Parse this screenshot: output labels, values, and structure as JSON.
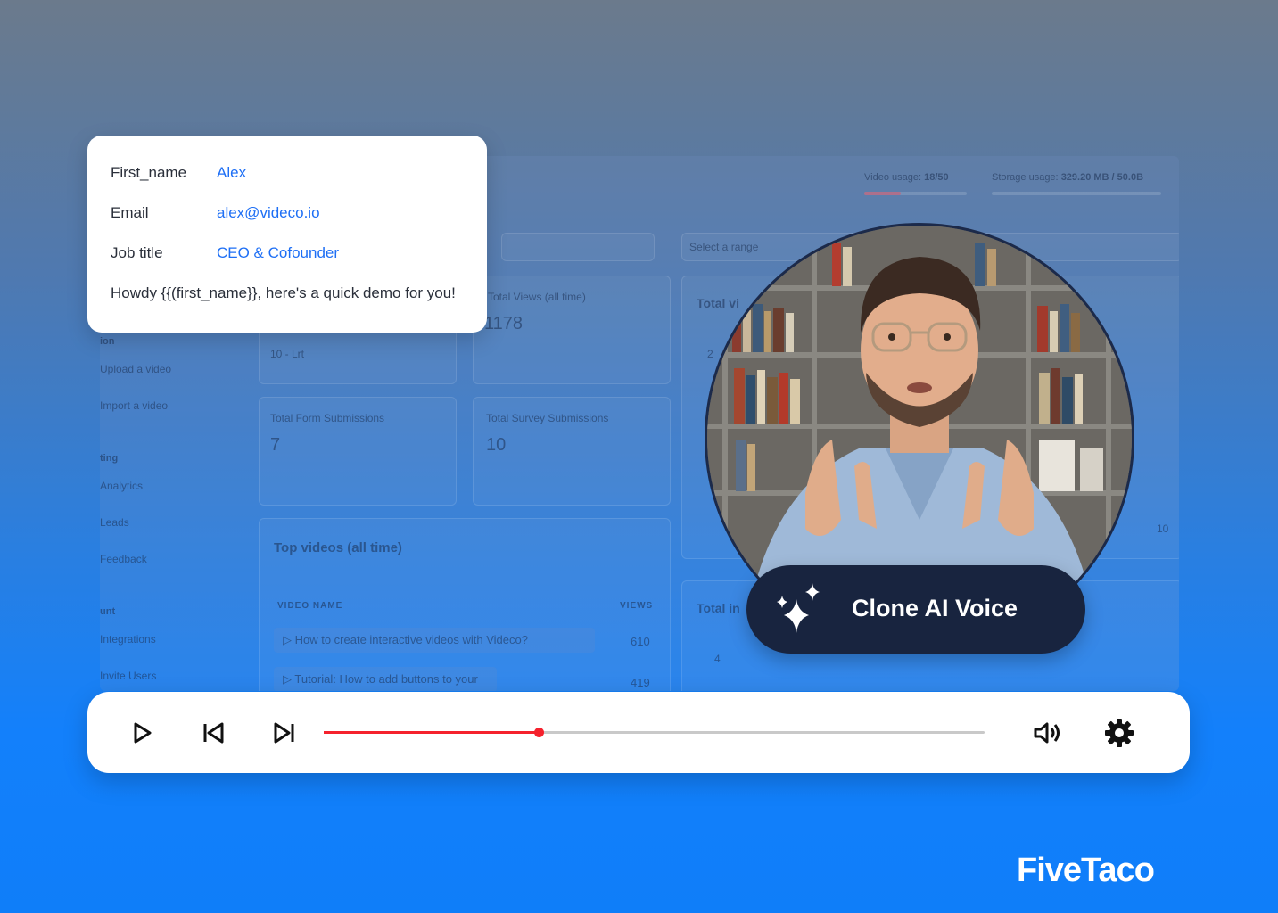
{
  "dashboard": {
    "video_usage_label": "Video usage:",
    "video_usage_value": "18/50",
    "video_usage_fraction": 0.36,
    "storage_usage_label": "Storage usage:",
    "storage_usage_value": "329.20 MB / 50.0B",
    "select_range": "Select a range",
    "total_views_label": "Total Views (all time)",
    "total_views_value": "1178",
    "range_hint": "10 - Lrt",
    "total_form_label": "Total Form Submissions",
    "total_form_value": "7",
    "total_survey_label": "Total Survey Submissions",
    "total_survey_value": "10",
    "total_vi_label": "Total vi",
    "total_in_label": "Total in",
    "top_videos_title": "Top videos (all time)",
    "col_video_name": "VIDEO NAME",
    "col_views": "VIEWS",
    "videos": [
      {
        "name": "How to create interactive videos with Videco?",
        "views": "610"
      },
      {
        "name": "Tutorial: How to add buttons to your video?",
        "views": "419"
      }
    ],
    "sidebar": [
      "ion",
      "Upload a video",
      "Import a video",
      "ting",
      "Analytics",
      "Leads",
      "Feedback",
      "unt",
      "Integrations",
      "Invite Users"
    ],
    "chart_ticks": [
      "2",
      "10",
      "4"
    ]
  },
  "card": {
    "first_name_label": "First_name",
    "first_name_value": "Alex",
    "email_label": "Email",
    "email_value": "alex@videco.io",
    "job_label": "Job title",
    "job_value": "CEO & Cofounder",
    "message": "Howdy {{(first_name}}, here's a quick demo for you!"
  },
  "badge": {
    "label": "Clone AI Voice",
    "icon": "sparkles-icon"
  },
  "player": {
    "progress_fraction": 0.325,
    "icons": [
      "play-icon",
      "skip-back-icon",
      "skip-forward-icon",
      "volume-icon",
      "gear-icon"
    ],
    "accent": "#f5222d"
  },
  "brand": {
    "logo": "FiveTaco"
  }
}
